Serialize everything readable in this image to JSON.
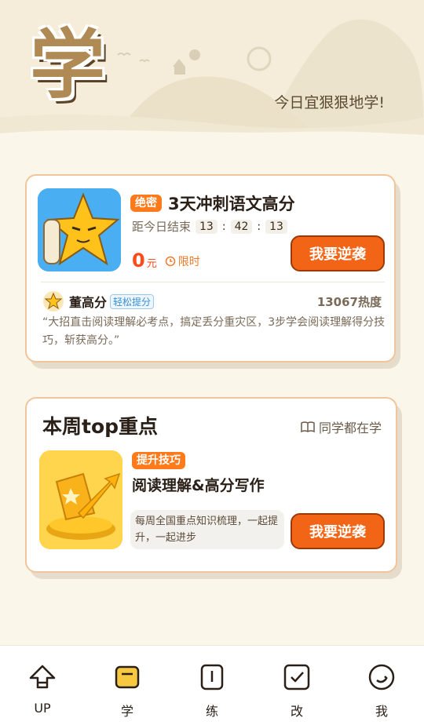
{
  "header": {
    "big_char": "学",
    "slogan": "今日宜狠狠地学!"
  },
  "featured": {
    "tag": "绝密",
    "title": "3天冲刺语文高分",
    "countdown_label": "距今日结束",
    "countdown": [
      "13",
      "42",
      "13"
    ],
    "price": "0",
    "price_unit": "元",
    "limited_label": "限时",
    "cta": "我要逆袭",
    "author": "董高分",
    "author_badge": "轻松提分",
    "heat": "13067热度",
    "quote": "“大招直击阅读理解必考点，搞定丢分重灾区，3步学会阅读理解得分技巧，斩获高分。”"
  },
  "weekly": {
    "title": "本周top重点",
    "right_label": "同学都在学",
    "tag": "提升技巧",
    "course": "阅读理解&高分写作",
    "desc": "每周全国重点知识梳理，一起提升，一起进步",
    "cta": "我要逆袭"
  },
  "nav": {
    "items": [
      {
        "label": "UP",
        "icon": "up-arrow-icon"
      },
      {
        "label": "学",
        "icon": "book-icon",
        "active": true
      },
      {
        "label": "练",
        "icon": "practice-icon"
      },
      {
        "label": "改",
        "icon": "check-icon"
      },
      {
        "label": "我",
        "icon": "profile-icon"
      }
    ]
  },
  "colors": {
    "accent": "#f36516",
    "tag": "#ff7a1a",
    "price": "#ff4a1a",
    "card_border": "#f2c49b",
    "active_nav": "#f7c940"
  }
}
